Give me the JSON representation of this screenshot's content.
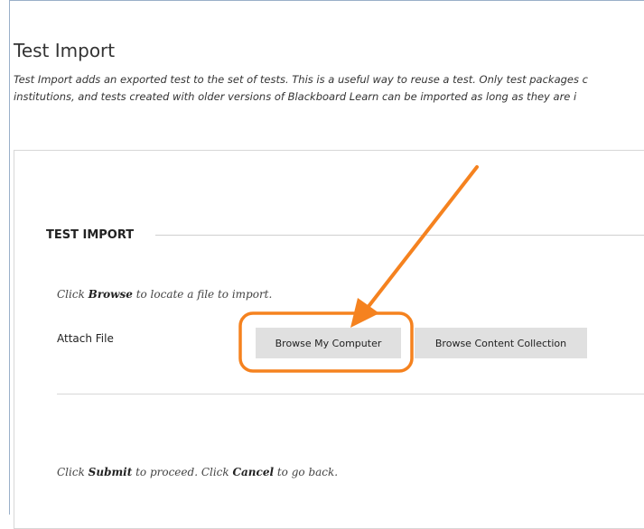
{
  "page": {
    "title": "Test Import",
    "description_line1": "Test Import adds an exported test to the set of tests. This is a useful way to reuse a test. Only test packages c",
    "description_line2": "institutions, and tests created with older versions of Blackboard Learn can be imported as long as they are i"
  },
  "section": {
    "heading": "TEST IMPORT"
  },
  "instruction": {
    "prefix": "Click ",
    "bold": "Browse",
    "suffix": " to locate a file to import."
  },
  "attach": {
    "label": "Attach File",
    "browse_computer_label": "Browse My Computer",
    "browse_collection_label": "Browse Content Collection"
  },
  "submit_instruction": {
    "part1": "Click ",
    "submit": "Submit",
    "part2": " to proceed. Click ",
    "cancel": "Cancel",
    "part3": " to go back."
  },
  "annotation": {
    "color": "#f5821f"
  }
}
